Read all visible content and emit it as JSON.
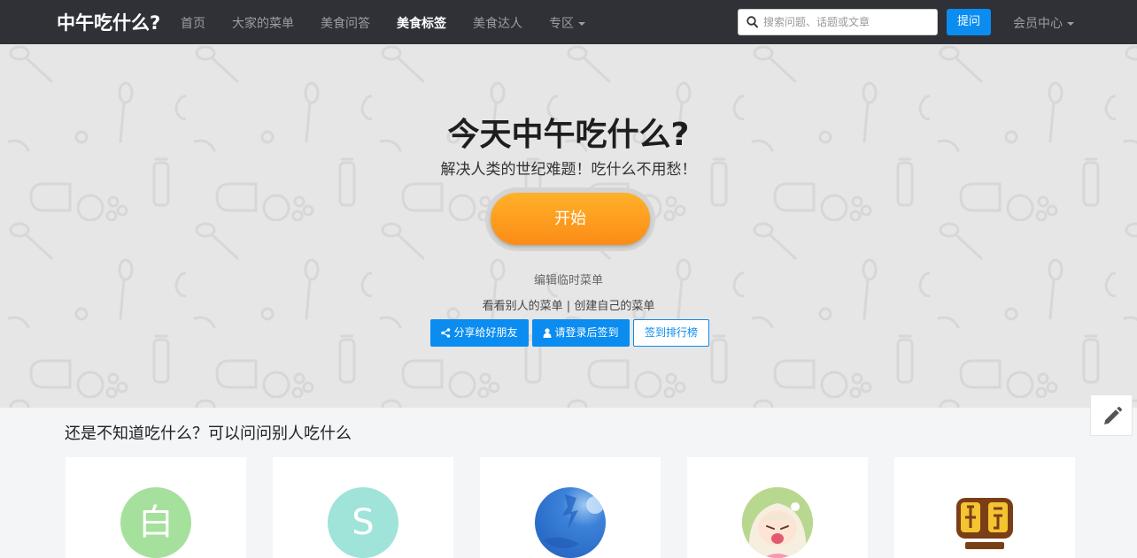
{
  "nav": {
    "brand": "中午吃什么?",
    "items": [
      {
        "label": "首页",
        "active": false
      },
      {
        "label": "大家的菜单",
        "active": false
      },
      {
        "label": "美食问答",
        "active": false
      },
      {
        "label": "美食标签",
        "active": true
      },
      {
        "label": "美食达人",
        "active": false
      },
      {
        "label": "专区",
        "active": false
      }
    ],
    "search_placeholder": "搜索问题、话题或文章",
    "ask_label": "提问",
    "member_label": "会员中心"
  },
  "hero": {
    "title": "今天中午吃什么?",
    "subtitle": "解决人类的世纪难题！吃什么不用愁！",
    "start_label": "开始",
    "edit_temp_menu": "编辑临时菜单",
    "view_others": "看看别人的菜单",
    "separator": "|",
    "create_own": "创建自己的菜单",
    "share_label": "分享给好朋友",
    "login_checkin_label": "请登录后签到",
    "ranking_label": "签到排行榜"
  },
  "users_section": {
    "title": "还是不知道吃什么？可以问问别人吃什么",
    "users": [
      {
        "avatar_text": "白",
        "avatar_color": "#a5e09c"
      },
      {
        "avatar_text": "S",
        "avatar_color": "#9fe3d9"
      },
      {
        "avatar_text": "",
        "avatar_color": "#2a6dc9"
      },
      {
        "avatar_text": "",
        "avatar_color": "#c7b49b"
      },
      {
        "avatar_text": "",
        "avatar_color": "#ffffff"
      }
    ]
  },
  "colors": {
    "navbar": "#2f3137",
    "accent": "#0a8cf0",
    "start_button": "#fb8c16",
    "hero_bg": "#e6e6e6"
  },
  "icons": [
    "search-icon",
    "share-icon",
    "user-icon",
    "pencil-icon",
    "dropdown-caret-icon"
  ]
}
